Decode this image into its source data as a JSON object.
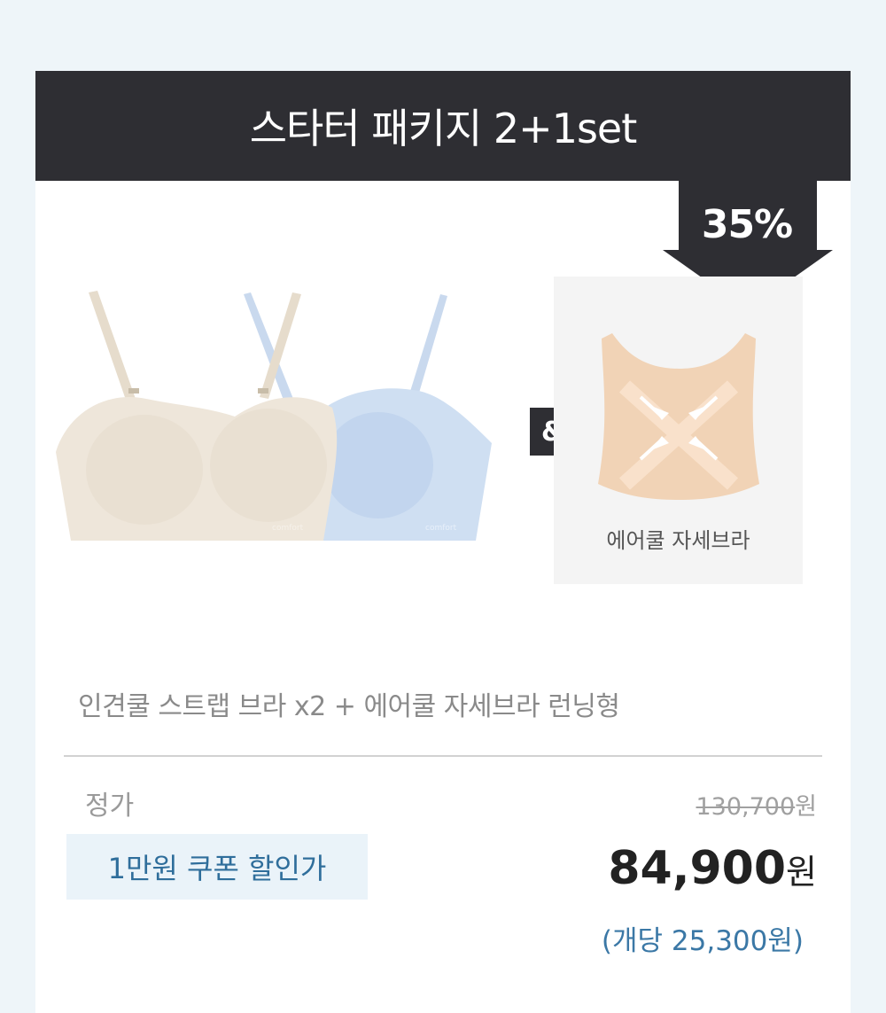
{
  "header": {
    "title": "스타터 패키지 2+1set"
  },
  "badge": {
    "discount": "35%"
  },
  "images": {
    "bras_alt": "인견쿨 스트랩 브라",
    "ampersand": "&",
    "posture_label": "에어쿨 자세브라"
  },
  "product": {
    "name": "인견쿨 스트랩 브라 x2 + 에어쿨 자세브라 런닝형"
  },
  "pricing": {
    "regular_label": "정가",
    "regular_price": "130,700",
    "currency": "원",
    "coupon_label": "1만원 쿠폰 할인가",
    "sale_price": "84,900",
    "unit_price": "(개당 25,300원)"
  },
  "colors": {
    "header_bg": "#2e2e33",
    "accent_blue": "#2f6e9b",
    "coupon_bg": "#eaf3f9",
    "page_bg": "#eef5f9"
  }
}
